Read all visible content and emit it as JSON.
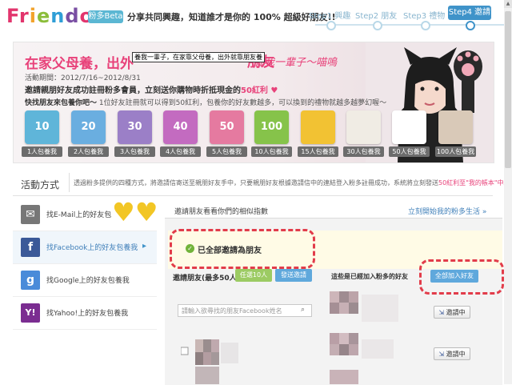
{
  "header": {
    "logo": "Friendo",
    "beta": "粉多Beta",
    "tagline": "分享共同興趣，知道誰才是你的 100% 超級好朋友!!",
    "steps": [
      "Step1 興趣",
      "Step2 朋友",
      "Step3 禮物",
      "Step4 邀請"
    ]
  },
  "banner": {
    "title": "在家父母養，出外",
    "title2": "朋友",
    "tooltip": "養我一輩子，在家靠父母養，出外就靠朋友養",
    "script": "養我一輩子～喵嗚",
    "date": "活動期間：2012/7/16~2012/8/31",
    "desc": "邀請親朋好友成功註冊粉多會員，立刻送你購物時折抵現金的",
    "desc_highlight": "50紅利",
    "sub_bold": "快找朋友來包養你吧～",
    "sub": "1位好友註冊就可以得到50紅利，包養你的好友數越多，可以換到的禮物就越多越夢幻喔～",
    "badges": [
      {
        "num": "10",
        "label": "1人包養我",
        "color": "#5fb5d9"
      },
      {
        "num": "20",
        "label": "2人包養我",
        "color": "#6aaee0"
      },
      {
        "num": "30",
        "label": "3人包養我",
        "color": "#9b7fc7"
      },
      {
        "num": "40",
        "label": "4人包養我",
        "color": "#c36bc0"
      },
      {
        "num": "50",
        "label": "5人包養我",
        "color": "#e57aa0"
      },
      {
        "num": "100",
        "label": "10人包養我",
        "color": "#86c34a"
      },
      {
        "num": "",
        "label": "15人包養我",
        "color": "#f2c233"
      },
      {
        "num": "",
        "label": "30人包養我",
        "color": "#f0ece4"
      },
      {
        "num": "",
        "label": "50人包養我",
        "color": "#ffffff"
      },
      {
        "num": "",
        "label": "100人包養我",
        "color": "#d9c9b8"
      }
    ]
  },
  "howto": {
    "label": "活動方式",
    "text": "透過粉多提供的四種方式，將邀請信寄送至親朋好友手中，只要親朋好友根據邀請信中的連結登入粉多註冊成功，系統將立刻發送",
    "highlight": "50紅利至",
    "link": "\"我的帳本\"中。"
  },
  "sidebar": {
    "items": [
      {
        "icon": "✉",
        "label": "找E-Mail上的好友包",
        "color": "#777777"
      },
      {
        "icon": "f",
        "label": "找Facebook上的好友包養我",
        "color": "#3b5998"
      },
      {
        "icon": "g",
        "label": "找Google上的好友包養我",
        "color": "#4a8bd9"
      },
      {
        "icon": "Y!",
        "label": "找Yahoo!上的好友包養我",
        "color": "#7b2d91"
      }
    ]
  },
  "panel": {
    "title": "邀請朋友看看你們的相似指數",
    "link": "立刻開始我的粉多生活 »",
    "notice": "已全部邀請為朋友",
    "col1_head": "邀請朋友(最多50人)",
    "btn_invite": "任選10人",
    "btn_send": "發送邀請",
    "search_placeholder": "請輸入欲尋找的朋友Facebook姓名",
    "col2_head": "這些是已經加入粉多的好友",
    "btn_all": "全部加入好友",
    "invite_buttons": [
      "邀請中",
      "邀請中"
    ]
  }
}
